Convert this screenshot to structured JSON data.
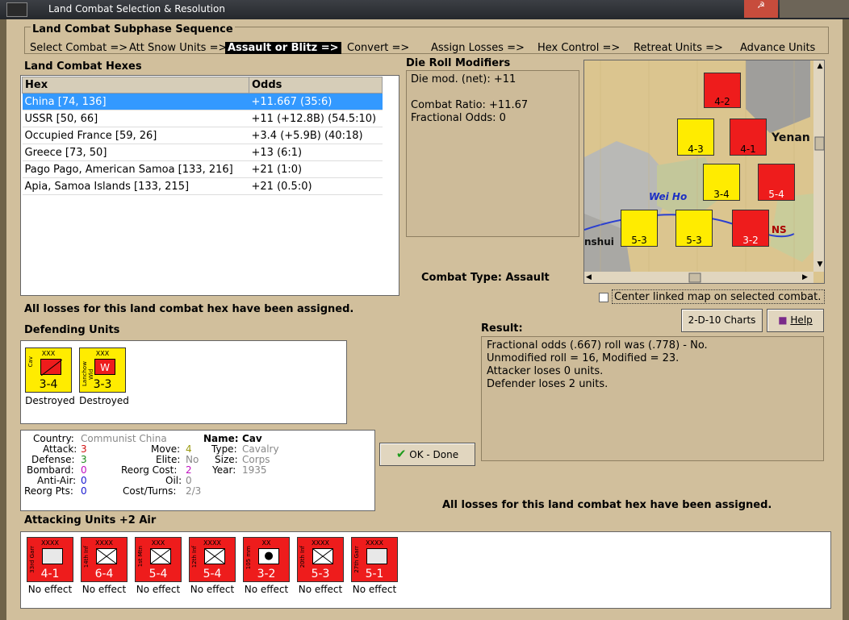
{
  "window": {
    "title": "Land Combat Selection & Resolution"
  },
  "sequence": {
    "title": "Land Combat Subphase Sequence",
    "steps": [
      "Select Combat =>",
      "Att Snow Units =>",
      "Assault or Blitz =>",
      "Convert =>",
      "Assign Losses =>",
      "Hex Control =>",
      "Retreat Units =>",
      "Advance Units"
    ],
    "active_index": 2
  },
  "hexes": {
    "title": "Land Combat Hexes",
    "columns": [
      "Hex",
      "Odds"
    ],
    "rows": [
      {
        "hex": "China [74, 136]",
        "odds": "+11.667 (35:6)",
        "selected": true
      },
      {
        "hex": "USSR [50, 66]",
        "odds": "+11 (+12.8B) (54.5:10)",
        "selected": false
      },
      {
        "hex": "Occupied France [59, 26]",
        "odds": "+3.4 (+5.9B) (40:18)",
        "selected": false
      },
      {
        "hex": "Greece [73, 50]",
        "odds": "+13 (6:1)",
        "selected": false
      },
      {
        "hex": "Pago Pago, American Samoa [133, 216]",
        "odds": "+21 (1:0)",
        "selected": false
      },
      {
        "hex": "Apia, Samoa Islands [133, 215]",
        "odds": "+21 (0.5:0)",
        "selected": false
      }
    ]
  },
  "die": {
    "title": "Die Roll Modifiers",
    "line1": "Die mod. (net): +11",
    "line2": "Combat Ratio: +11.67",
    "line3": "Fractional Odds: 0"
  },
  "combat_type": {
    "label": "Combat Type:",
    "value": "Assault"
  },
  "center_map": {
    "label": "Center linked map on selected combat.",
    "checked": false
  },
  "losses_msg_top": "All losses for this land combat hex have been assigned.",
  "losses_msg_bottom": "All losses for this land combat hex have been assigned.",
  "defending": {
    "title": "Defending Units",
    "units": [
      {
        "name": "Cav",
        "size": "XXX",
        "vals": "3-4",
        "status": "Destroyed",
        "color": "#ffec00",
        "symbol": "cavalry"
      },
      {
        "name": "Lanchow Wld",
        "size": "XXX",
        "vals": "3-3",
        "status": "Destroyed",
        "color": "#ffec00",
        "symbol": "W"
      }
    ]
  },
  "result": {
    "title": "Result:",
    "lines": [
      "Fractional odds (.667) roll was (.778)  - No.",
      "Unmodified roll = 16, Modified = 23.",
      "Attacker loses 0 units.",
      "Defender loses 2 units."
    ]
  },
  "buttons": {
    "charts": "2-D-10 Charts",
    "help": "Help",
    "done": "OK - Done"
  },
  "info": {
    "country_label": "Country:",
    "country": "Communist China",
    "attack_label": "Attack:",
    "attack": "3",
    "defense_label": "Defense:",
    "defense": "3",
    "bombard_label": "Bombard:",
    "bombard": "0",
    "antiair_label": "Anti-Air:",
    "antiair": "0",
    "reorgpts_label": "Reorg Pts:",
    "reorgpts": "0",
    "move_label": "Move:",
    "move": "4",
    "elite_label": "Elite:",
    "elite": "No",
    "reorgcost_label": "Reorg Cost:",
    "reorgcost": "2",
    "oil_label": "Oil:",
    "oil": "0",
    "costturns_label": "Cost/Turns:",
    "costturns": "2/3",
    "name_label": "Name:",
    "name": "Cav",
    "type_label": "Type:",
    "type": "Cavalry",
    "size_label": "Size:",
    "size": "Corps",
    "year_label": "Year:",
    "year": "1935"
  },
  "attacking": {
    "title": "Attacking Units +2 Air",
    "units": [
      {
        "name": "33rd Garr",
        "size": "XXXX",
        "vals": "4-1",
        "effect": "No effect",
        "color": "#ee1c1c"
      },
      {
        "name": "14th Inf",
        "size": "XXXX",
        "vals": "6-4",
        "effect": "No effect",
        "color": "#ee1c1c"
      },
      {
        "name": "1st Mtn",
        "size": "XXX",
        "vals": "5-4",
        "effect": "No effect",
        "color": "#ee1c1c"
      },
      {
        "name": "12th Inf",
        "size": "XXXX",
        "vals": "5-4",
        "effect": "No effect",
        "color": "#ee1c1c"
      },
      {
        "name": "105 mm",
        "size": "XX",
        "vals": "3-2",
        "effect": "No effect",
        "color": "#ee1c1c"
      },
      {
        "name": "20th Inf",
        "size": "XXXX",
        "vals": "5-3",
        "effect": "No effect",
        "color": "#ee1c1c"
      },
      {
        "name": "27th Garr",
        "size": "XXXX",
        "vals": "5-1",
        "effect": "No effect",
        "color": "#ee1c1c"
      }
    ]
  },
  "map": {
    "labels": [
      "Yenan",
      "Wei Ho",
      "nshui",
      "NS"
    ],
    "counters": [
      {
        "vals": "4-2",
        "color": "#ee1c1c"
      },
      {
        "vals": "4-3",
        "color": "#ffec00"
      },
      {
        "vals": "4-1",
        "color": "#ee1c1c"
      },
      {
        "vals": "3-4",
        "color": "#ffec00"
      },
      {
        "vals": "5-4",
        "color": "#ee1c1c"
      },
      {
        "vals": "5-3",
        "color": "#ffec00"
      },
      {
        "vals": "5-3",
        "color": "#ffec00"
      },
      {
        "vals": "3-2",
        "color": "#ee1c1c"
      }
    ]
  }
}
